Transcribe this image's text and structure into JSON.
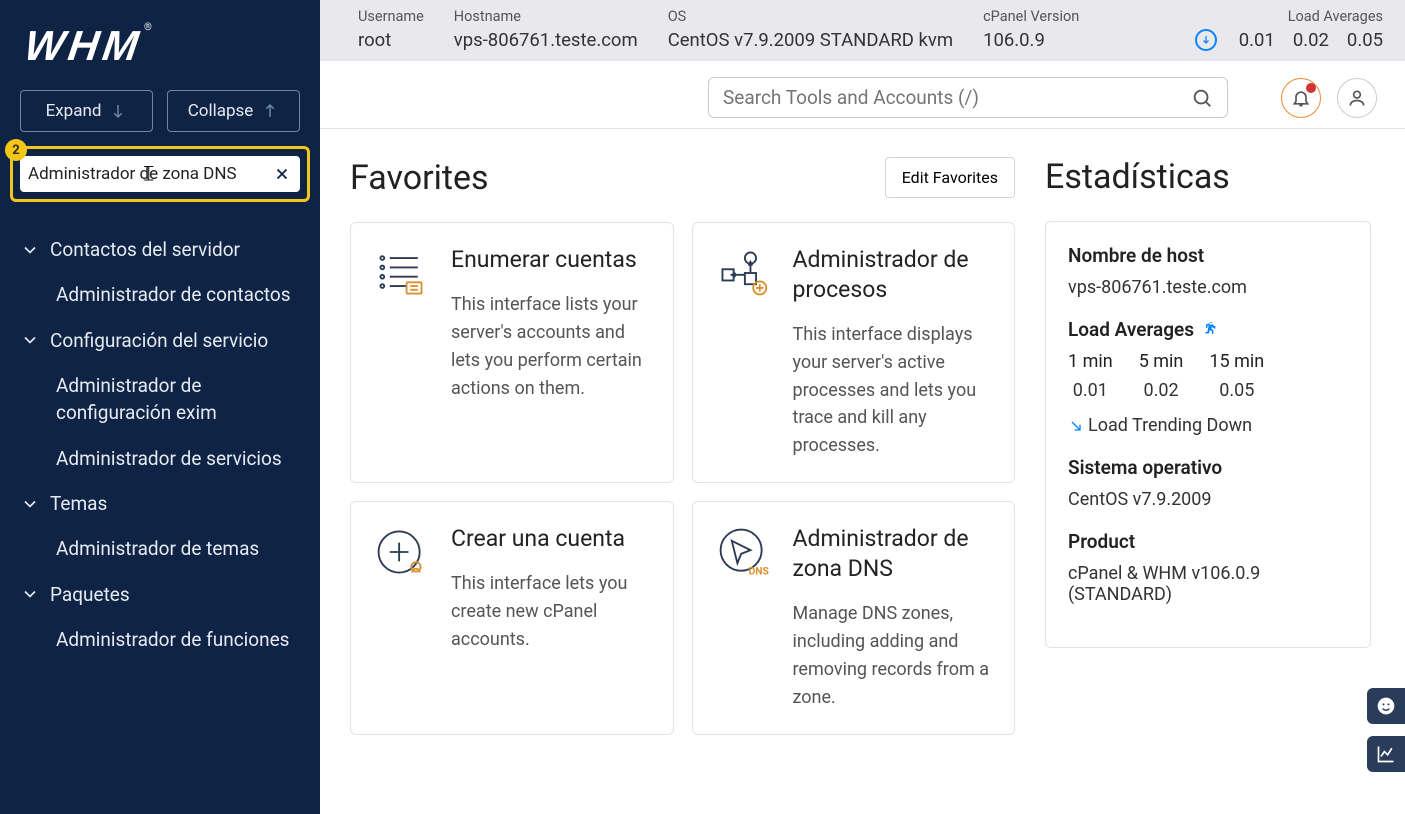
{
  "logo_text": "WHM",
  "expand_label": "Expand",
  "collapse_label": "Collapse",
  "sidebar_search_value": "Administrador de zona DNS",
  "sidebar_search_badge": "2",
  "nav_groups": [
    {
      "title": "Contactos del servidor",
      "items": [
        "Administrador de contactos"
      ]
    },
    {
      "title": "Configuración del servicio",
      "items": [
        "Administrador de configuración exim",
        "Administrador de servicios"
      ]
    },
    {
      "title": "Temas",
      "items": [
        "Administrador de temas"
      ]
    },
    {
      "title": "Paquetes",
      "items": [
        "Administrador de funciones"
      ]
    }
  ],
  "infobar": {
    "username_lbl": "Username",
    "username_val": "root",
    "hostname_lbl": "Hostname",
    "hostname_val": "vps-806761.teste.com",
    "os_lbl": "OS",
    "os_val": "CentOS v7.9.2009 STANDARD kvm",
    "cpv_lbl": "cPanel Version",
    "cpv_val": "106.0.9",
    "la_lbl": "Load Averages",
    "la_1": "0.01",
    "la_5": "0.02",
    "la_15": "0.05"
  },
  "tools_search_placeholder": "Search Tools and Accounts (/)",
  "favorites_title": "Favorites",
  "edit_favorites_label": "Edit Favorites",
  "cards": {
    "c0": {
      "title": "Enumerar cuentas",
      "desc": "This interface lists your server's accounts and lets you perform certain actions on them."
    },
    "c1": {
      "title": "Administrador de procesos",
      "desc": "This interface displays your server's active processes and lets you trace and kill any processes."
    },
    "c2": {
      "title": "Crear una cuenta",
      "desc": "This interface lets you create new cPanel accounts."
    },
    "c3": {
      "title": "Administrador de zona DNS",
      "desc": "Manage DNS zones, including adding and removing records from a zone."
    }
  },
  "stats_title": "Estadísticas",
  "stats": {
    "hostname_lbl": "Nombre de host",
    "hostname_val": "vps-806761.teste.com",
    "la_lbl": "Load Averages",
    "la_cols": {
      "c0": "1 min",
      "c1": "5 min",
      "c2": "15 min",
      "v0": "0.01",
      "v1": "0.02",
      "v2": "0.05"
    },
    "trend": "Load Trending Down",
    "os_lbl": "Sistema operativo",
    "os_val": "CentOS v7.9.2009",
    "prod_lbl": "Product",
    "prod_val": "cPanel & WHM v106.0.9 (STANDARD)"
  }
}
